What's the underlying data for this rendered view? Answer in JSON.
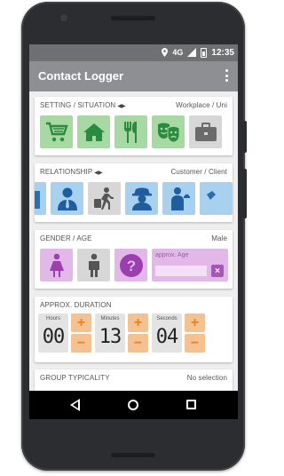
{
  "status_bar": {
    "time": "12:35",
    "network": "4G",
    "icons": [
      "location-icon",
      "signal-icon",
      "battery-icon"
    ]
  },
  "app_bar": {
    "title": "Contact Logger",
    "menu_icon": "overflow-menu-icon"
  },
  "setting": {
    "label": "SETTING / SITUATION",
    "value": "Workplace / Uni",
    "items": [
      "shopping-cart-icon",
      "home-icon",
      "restaurant-icon",
      "theater-masks-icon",
      "briefcase-icon"
    ]
  },
  "relationship": {
    "label": "RELATIONSHIP",
    "value": "Customer / Client",
    "items": [
      "partial-icon",
      "business-person-icon",
      "traveler-icon",
      "detective-icon",
      "waiter-icon",
      "partial-icon"
    ]
  },
  "gender_age": {
    "label": "GENDER / AGE",
    "value": "Male",
    "items": [
      "female-icon",
      "male-icon",
      "unknown-gender-icon"
    ],
    "age_placeholder": "approx. Age",
    "clear_label": "×"
  },
  "duration": {
    "label": "APPROX. DURATION",
    "hours_caption": "Hours",
    "hours": "00",
    "minutes_caption": "Minutes",
    "minutes": "13",
    "seconds_caption": "Seconds",
    "seconds": "04",
    "plus": "+",
    "minus": "−"
  },
  "group": {
    "label": "GROUP TYPICALITY",
    "value": "No selection"
  },
  "colors": {
    "accent_green": "#a8d8a4",
    "accent_blue": "#a7d1ee",
    "accent_pink": "#e2b8e8",
    "accent_orange": "#f4c291",
    "appbar": "#8d8f92"
  }
}
